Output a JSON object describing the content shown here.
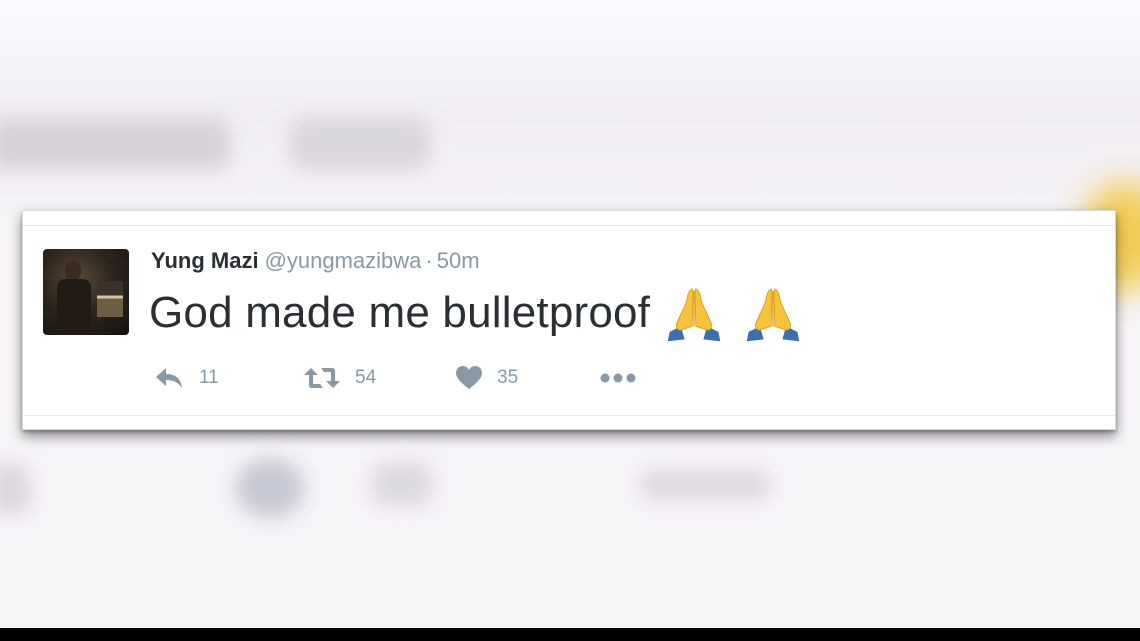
{
  "tweet": {
    "display_name": "Yung Mazi",
    "handle": "@yungmazibwa",
    "separator": "·",
    "timestamp": "50m",
    "text": "God made me bulletproof",
    "emojis": [
      "folded-hands-emoji",
      "folded-hands-emoji"
    ],
    "actions": {
      "reply": {
        "icon": "reply-icon",
        "count": "11"
      },
      "retweet": {
        "icon": "retweet-icon",
        "count": "54"
      },
      "like": {
        "icon": "heart-icon",
        "count": "35"
      },
      "more": {
        "icon": "more-dots-icon"
      }
    }
  },
  "colors": {
    "text_primary": "#292f33",
    "text_secondary": "#8899a6",
    "emoji_skin": "#f5c23a",
    "emoji_sleeve": "#3b6fb0"
  }
}
